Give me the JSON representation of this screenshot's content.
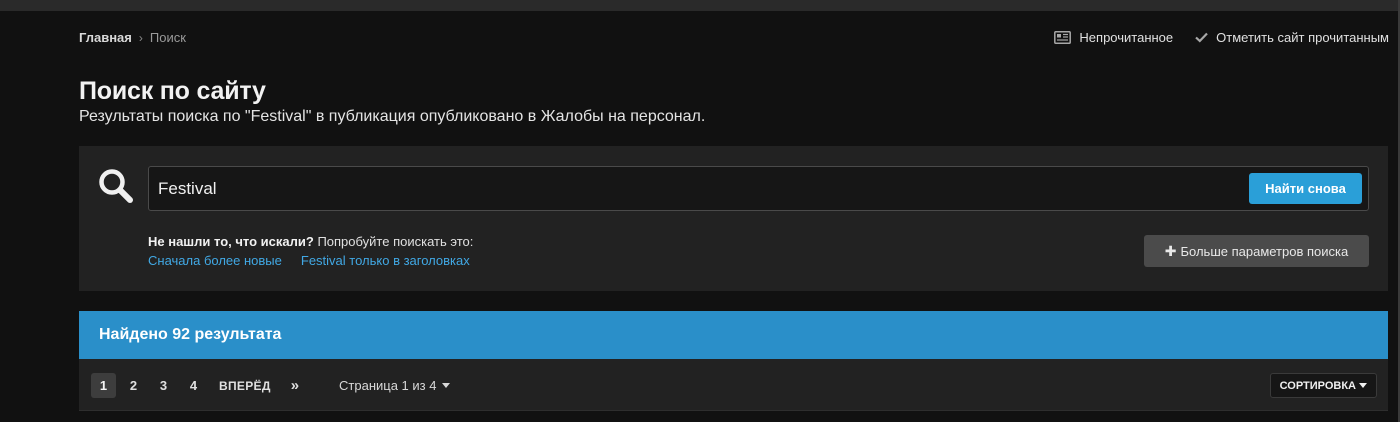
{
  "breadcrumb": {
    "home": "Главная",
    "current": "Поиск"
  },
  "top_actions": {
    "unread": "Непрочитанное",
    "mark_read": "Отметить сайт прочитанным"
  },
  "header": {
    "title": "Поиск по сайту",
    "subtitle": "Результаты поиска по \"Festival\" в публикация опубликовано в Жалобы на персонал."
  },
  "search": {
    "query": "Festival",
    "button_label": "Найти снова",
    "suggest_bold": "Не нашли то, что искали?",
    "suggest_text": " Попробуйте поискать это:",
    "suggest_links": [
      "Сначала более новые",
      "Festival только в заголовках"
    ],
    "more_options_label": "Больше параметров поиска"
  },
  "results": {
    "count_label": "Найдено 92 результата",
    "pages": [
      "1",
      "2",
      "3",
      "4"
    ],
    "active_page": "1",
    "next_label": "ВПЕРЁД",
    "last_label": "»",
    "page_info": "Страница 1 из 4",
    "sort_label": "СОРТИРОВКА"
  },
  "colors": {
    "accent": "#2a9fd8",
    "results_header": "#2a8fc9",
    "link": "#41a8e4",
    "background": "#111111",
    "panel": "#222222"
  },
  "icons": {
    "search": "search-icon",
    "unread": "newspaper-icon",
    "mark_read": "checkmark-icon"
  }
}
